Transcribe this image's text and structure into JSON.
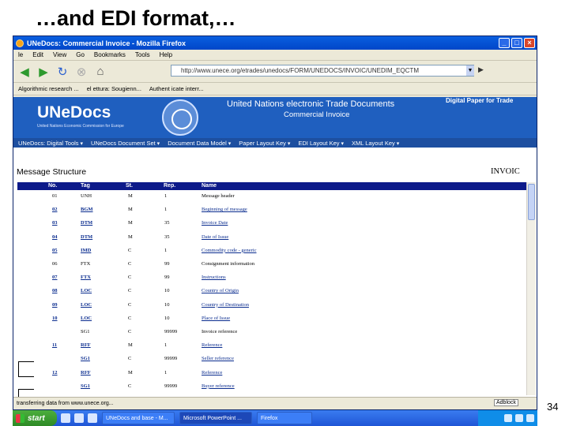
{
  "slide": {
    "title": "…and EDI format,…",
    "page_number": "34"
  },
  "browser": {
    "window_title": "UNeDocs: Commercial Invoice - Mozilla Firefox",
    "menu": [
      "le",
      "Edit",
      "View",
      "Go",
      "Bookmarks",
      "Tools",
      "Help"
    ],
    "url": "http://www.unece.org/etrades/unedocs/FORM/UNEDOCS/INVOIC/UNEDIM_EQCTM",
    "bookmarks": [
      "Algorithmic research ...",
      "el ettura: Sougienn...",
      "Authent icate interr..."
    ],
    "status_text": "transferring data from www.unece.org...",
    "adblock_label": "Adblock",
    "icons": {
      "back": "arrow-back-icon",
      "forward": "arrow-forward-icon",
      "reload": "reload-icon",
      "stop": "stop-icon",
      "home": "home-icon"
    }
  },
  "banner": {
    "logo": "UNeDocs",
    "logo_subtitle": "United Nations Economic Commission for Europe",
    "title": "United Nations electronic Trade Documents",
    "subtitle": "Commercial Invoice",
    "tagline": "Digital Paper for Trade",
    "nav": [
      "UNeDocs: Digital Tools",
      "UNeDocs Document Set",
      "Document Data Model",
      "Paper Layout Key",
      "EDI Layout Key",
      "XML Layout Key"
    ]
  },
  "structure": {
    "heading": "Message Structure",
    "code": "INVOIC",
    "columns": [
      "No.",
      "Tag",
      "St.",
      "Rep.",
      "Name"
    ],
    "rows": [
      {
        "no": "01",
        "tag": "UNH",
        "st": "M",
        "rep": "1",
        "name": "Message header",
        "link": false
      },
      {
        "no": "02",
        "tag": "BGM",
        "st": "M",
        "rep": "1",
        "name": "Beginning of message",
        "link": true
      },
      {
        "no": "03",
        "tag": "DTM",
        "st": "M",
        "rep": "35",
        "name": "Invoice Date",
        "link": true
      },
      {
        "no": "04",
        "tag": "DTM",
        "st": "M",
        "rep": "35",
        "name": "Date of Issue",
        "link": true
      },
      {
        "no": "05",
        "tag": "IMD",
        "st": "C",
        "rep": "1",
        "name": "Commodity code - generic",
        "link": true
      },
      {
        "no": "06",
        "tag": "FTX",
        "st": "C",
        "rep": "99",
        "name": "Consignment information",
        "link": false
      },
      {
        "no": "07",
        "tag": "FTX",
        "st": "C",
        "rep": "99",
        "name": "Instructions",
        "link": true
      },
      {
        "no": "08",
        "tag": "LOC",
        "st": "C",
        "rep": "10",
        "name": "Country of Origin",
        "link": true
      },
      {
        "no": "09",
        "tag": "LOC",
        "st": "C",
        "rep": "10",
        "name": "Country of Destination",
        "link": true
      },
      {
        "no": "10",
        "tag": "LOC",
        "st": "C",
        "rep": "10",
        "name": "Place of Issue",
        "link": true
      },
      {
        "no": "",
        "tag": "SG1",
        "st": "C",
        "rep": "99999",
        "name": "Invoice reference",
        "link": false
      },
      {
        "no": "11",
        "tag": "RFF",
        "st": "M",
        "rep": "1",
        "name": "Reference",
        "link": true
      },
      {
        "no": "",
        "tag": "SG1",
        "st": "C",
        "rep": "99999",
        "name": "Seller reference",
        "link": true
      },
      {
        "no": "12",
        "tag": "RFF",
        "st": "M",
        "rep": "1",
        "name": "Reference",
        "link": true
      },
      {
        "no": "",
        "tag": "SG1",
        "st": "C",
        "rep": "99999",
        "name": "Buyer reference",
        "link": true
      }
    ]
  },
  "taskbar": {
    "start_label": "start",
    "tasks": [
      "UNeDocs and base - M...",
      "Microsoft PowerPoint ...",
      "Firefox"
    ]
  }
}
